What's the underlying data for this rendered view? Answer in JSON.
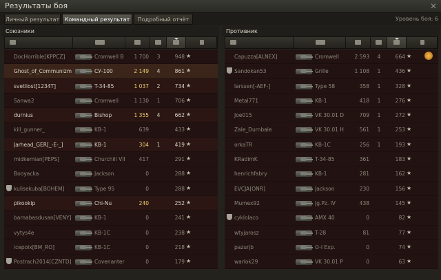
{
  "window": {
    "title": "Результаты боя",
    "close_icon": "close-icon"
  },
  "tabs": [
    {
      "label": "Личный результат"
    },
    {
      "label": "Командный результат"
    },
    {
      "label": "Подробный отчёт"
    }
  ],
  "level_text": "Уровень боя: 6",
  "allies": {
    "title": "Союзники",
    "rows": [
      {
        "name": "DocHorrible[KPPCZ]",
        "veh": "Cromwell B",
        "dmg": "1 700",
        "frags": "3",
        "xp": "948",
        "dead": true,
        "me": false,
        "clan": false
      },
      {
        "name": "Ghost_of_Communizm",
        "veh": "СУ-100",
        "dmg": "2 149",
        "frags": "4",
        "xp": "861",
        "dead": false,
        "me": true,
        "clan": false
      },
      {
        "name": "svetliost[1234T]",
        "veh": "T-34-85",
        "dmg": "1 037",
        "frags": "2",
        "xp": "734",
        "dead": false,
        "me": false,
        "clan": false
      },
      {
        "name": "Sanwa2",
        "veh": "Cromwell",
        "dmg": "1 130",
        "frags": "1",
        "xp": "706",
        "dead": true,
        "me": false,
        "clan": false
      },
      {
        "name": "durnius",
        "veh": "Bishop",
        "dmg": "1 355",
        "frags": "4",
        "xp": "662",
        "dead": false,
        "me": false,
        "clan": false
      },
      {
        "name": "kill_gunner_",
        "veh": "KB-1",
        "dmg": "639",
        "frags": "",
        "xp": "433",
        "dead": true,
        "me": false,
        "clan": false
      },
      {
        "name": "Jarhead_GER[_-E-_]",
        "veh": "KB-1",
        "dmg": "304",
        "frags": "1",
        "xp": "419",
        "dead": false,
        "me": false,
        "clan": false
      },
      {
        "name": "midkemian[PEPS]",
        "veh": "Churchill VII",
        "dmg": "417",
        "frags": "",
        "xp": "291",
        "dead": true,
        "me": false,
        "clan": false
      },
      {
        "name": "Booyacka",
        "veh": "Jackson",
        "dmg": "0",
        "frags": "",
        "xp": "288",
        "dead": true,
        "me": false,
        "clan": false
      },
      {
        "name": "kulisekuba[BOHEM]",
        "veh": "Type 95",
        "dmg": "0",
        "frags": "",
        "xp": "288",
        "dead": true,
        "me": false,
        "clan": true
      },
      {
        "name": "pikookip",
        "veh": "Chi-Nu",
        "dmg": "240",
        "frags": "",
        "xp": "252",
        "dead": false,
        "me": false,
        "clan": false
      },
      {
        "name": "barnabasdusan[VENY]",
        "veh": "KB-1",
        "dmg": "0",
        "frags": "",
        "xp": "241",
        "dead": true,
        "me": false,
        "clan": false
      },
      {
        "name": "vytys4e",
        "veh": "KB-1C",
        "dmg": "0",
        "frags": "",
        "xp": "238",
        "dead": true,
        "me": false,
        "clan": false
      },
      {
        "name": "icepolx[BM_RO]",
        "veh": "KB-1C",
        "dmg": "0",
        "frags": "",
        "xp": "218",
        "dead": true,
        "me": false,
        "clan": false
      },
      {
        "name": "Postrach2014[CZNTD]",
        "veh": "Covenanter",
        "dmg": "0",
        "frags": "",
        "xp": "179",
        "dead": true,
        "me": false,
        "clan": true
      }
    ]
  },
  "enemies": {
    "title": "Противник",
    "rows": [
      {
        "name": "Capuzza[ALNEX]",
        "veh": "Cromwell",
        "dmg": "2 593",
        "frags": "4",
        "xp": "664",
        "dead": true,
        "me": false,
        "clan": false,
        "ach": true
      },
      {
        "name": "Sandokan53",
        "veh": "Grille",
        "dmg": "1 108",
        "frags": "1",
        "xp": "436",
        "dead": true,
        "me": false,
        "clan": true,
        "ach": false
      },
      {
        "name": "larssen[-AEF-]",
        "veh": "Type 58",
        "dmg": "358",
        "frags": "1",
        "xp": "328",
        "dead": true,
        "me": false,
        "clan": false,
        "ach": false
      },
      {
        "name": "Metal771",
        "veh": "KB-1",
        "dmg": "418",
        "frags": "1",
        "xp": "276",
        "dead": true,
        "me": false,
        "clan": false,
        "ach": false
      },
      {
        "name": "Joe015",
        "veh": "VK 30.01 D",
        "dmg": "709",
        "frags": "1",
        "xp": "272",
        "dead": true,
        "me": false,
        "clan": false,
        "ach": false
      },
      {
        "name": "Zale_Durnbale",
        "veh": "VK 30.01 H",
        "dmg": "561",
        "frags": "1",
        "xp": "253",
        "dead": true,
        "me": false,
        "clan": false,
        "ach": false
      },
      {
        "name": "orkaTR",
        "veh": "KB-1C",
        "dmg": "256",
        "frags": "1",
        "xp": "193",
        "dead": true,
        "me": false,
        "clan": false,
        "ach": false
      },
      {
        "name": "KRadimK",
        "veh": "T-34-85",
        "dmg": "361",
        "frags": "",
        "xp": "183",
        "dead": true,
        "me": false,
        "clan": false,
        "ach": false
      },
      {
        "name": "henrichfabry",
        "veh": "KB-1",
        "dmg": "281",
        "frags": "",
        "xp": "162",
        "dead": true,
        "me": false,
        "clan": false,
        "ach": false
      },
      {
        "name": "EVCJA[ONR]",
        "veh": "Jackson",
        "dmg": "230",
        "frags": "",
        "xp": "156",
        "dead": true,
        "me": false,
        "clan": false,
        "ach": false
      },
      {
        "name": "Mumex92",
        "veh": "Jg.Pz. IV",
        "dmg": "438",
        "frags": "",
        "xp": "145",
        "dead": true,
        "me": false,
        "clan": false,
        "ach": false
      },
      {
        "name": "cyklolaco",
        "veh": "AMX 40",
        "dmg": "0",
        "frags": "",
        "xp": "82",
        "dead": true,
        "me": false,
        "clan": true,
        "ach": false
      },
      {
        "name": "wtyjarosz",
        "veh": "T-28",
        "dmg": "81",
        "frags": "",
        "xp": "77",
        "dead": true,
        "me": false,
        "clan": false,
        "ach": false
      },
      {
        "name": "pazurjb",
        "veh": "O-I Exp.",
        "dmg": "0",
        "frags": "",
        "xp": "74",
        "dead": true,
        "me": false,
        "clan": false,
        "ach": false
      },
      {
        "name": "warlok29",
        "veh": "VK 30.01 P",
        "dmg": "0",
        "frags": "",
        "xp": "63",
        "dead": true,
        "me": false,
        "clan": false,
        "ach": false
      }
    ]
  },
  "colors": {
    "row_alive": "#2b1614",
    "row_dead": "#221312",
    "self_row": "#3b251b",
    "damage_highlight": "#f0cf6e"
  }
}
